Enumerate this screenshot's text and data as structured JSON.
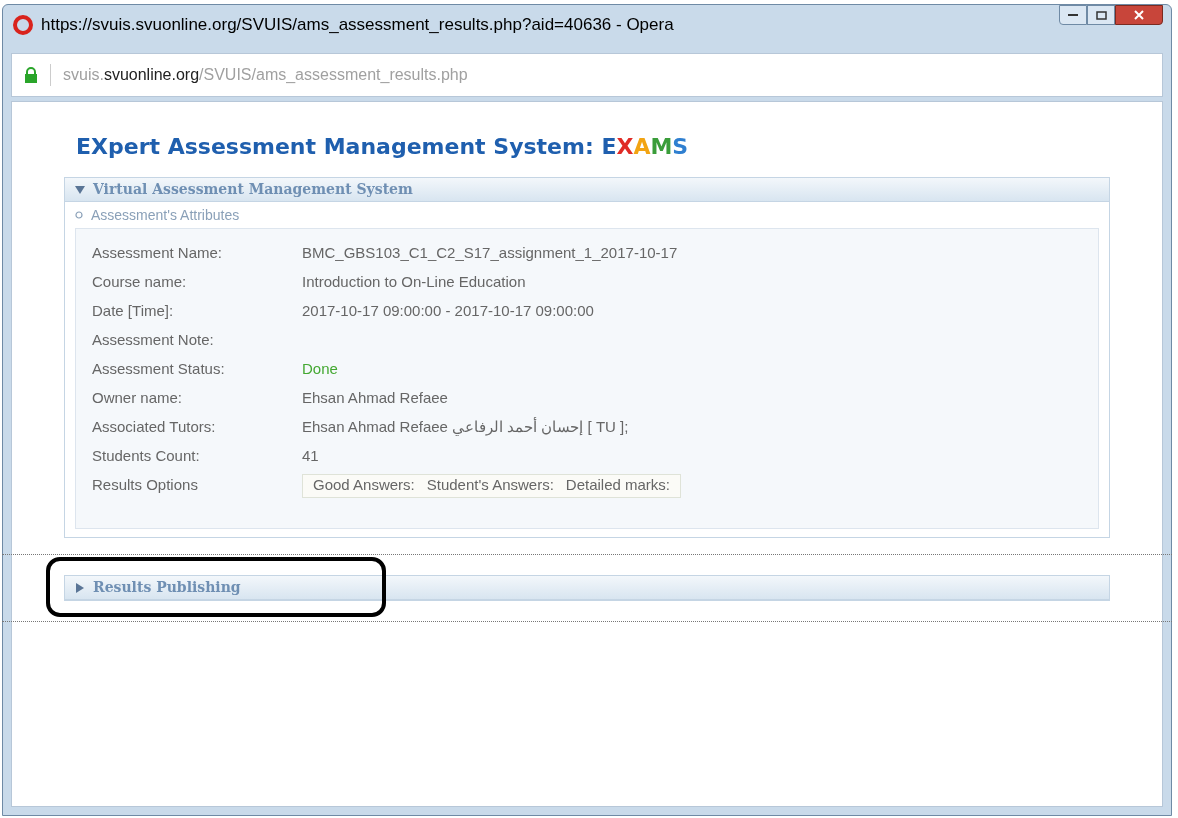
{
  "window": {
    "title": "https://svuis.svuonline.org/SVUIS/ams_assessment_results.php?aid=40636 - Opera"
  },
  "address_bar": {
    "subdomain": "svuis.",
    "domain": "svuonline.org",
    "path": "/SVUIS/ams_assessment_results.php",
    "secure": true
  },
  "page_title": {
    "text": "EXpert Assessment Management System: ",
    "logo": [
      {
        "letter": "E",
        "color": "#1f5fae"
      },
      {
        "letter": "X",
        "color": "#e02b26"
      },
      {
        "letter": "A",
        "color": "#f2a413"
      },
      {
        "letter": "M",
        "color": "#3a9d3a"
      },
      {
        "letter": "S",
        "color": "#2f7fd0"
      }
    ]
  },
  "sections": [
    {
      "title": "Virtual Assessment Management System",
      "expanded": true,
      "subsection": "Assessment's Attributes",
      "attributes": [
        {
          "kind": "text",
          "label": "Assessment Name:",
          "value": "BMC_GBS103_C1_C2_S17_assignment_1_2017-10-17"
        },
        {
          "kind": "text",
          "label": "Course name:",
          "value": "Introduction to On-Line Education"
        },
        {
          "kind": "text",
          "label": "Date [Time]:",
          "value": "2017-10-17 09:00:00 - 2017-10-17 09:00:00"
        },
        {
          "kind": "text",
          "label": "Assessment Note:"
        },
        {
          "kind": "status",
          "label": "Assessment Status:",
          "value": "Done",
          "color": "#44a832"
        },
        {
          "kind": "text",
          "label": "Owner name:",
          "value": "Ehsan Ahmad Refaee"
        },
        {
          "kind": "text",
          "label": "Associated Tutors:",
          "value": "Ehsan Ahmad Refaee إحسان أحمد الرفاعي [ TU ];"
        },
        {
          "kind": "text",
          "label": "Students Count:",
          "value": "41"
        },
        {
          "kind": "options",
          "label": "Results Options",
          "options": [
            "Good Answers:",
            "Student's Answers:",
            "Detailed marks:"
          ]
        }
      ]
    },
    {
      "title": "Results Publishing",
      "expanded": false,
      "highlighted": true
    }
  ]
}
